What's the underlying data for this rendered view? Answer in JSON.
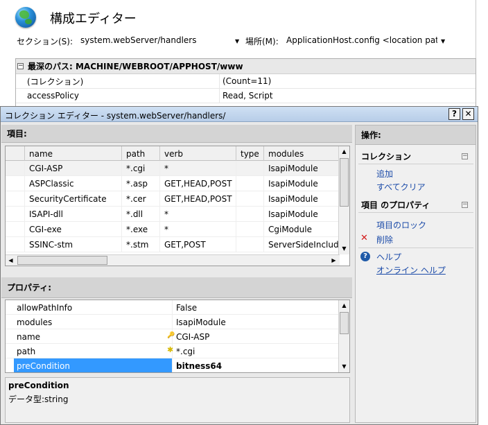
{
  "background": {
    "title": "構成エディター",
    "section_label": "セクション(S):",
    "section_value": "system.webServer/handlers",
    "location_label": "場所(M):",
    "location_value": "ApplicationHost.config <location path",
    "path_header": "最深のパス: MACHINE/WEBROOT/APPHOST/www",
    "rows": [
      {
        "name": "(コレクション)",
        "value": "(Count=11)"
      },
      {
        "name": "accessPolicy",
        "value": "Read, Script"
      }
    ]
  },
  "dialog": {
    "title": "コレクション エディター - system.webServer/handlers/",
    "help_btn": "?",
    "close_btn": "✕",
    "items_header": "項目:",
    "columns": [
      "name",
      "path",
      "verb",
      "type",
      "modules"
    ],
    "items": [
      {
        "name": "CGI-ASP",
        "path": "*.cgi",
        "verb": "*",
        "type": "",
        "modules": "IsapiModule"
      },
      {
        "name": "ASPClassic",
        "path": "*.asp",
        "verb": "GET,HEAD,POST",
        "type": "",
        "modules": "IsapiModule"
      },
      {
        "name": "SecurityCertificate",
        "path": "*.cer",
        "verb": "GET,HEAD,POST",
        "type": "",
        "modules": "IsapiModule"
      },
      {
        "name": "ISAPI-dll",
        "path": "*.dll",
        "verb": "*",
        "type": "",
        "modules": "IsapiModule"
      },
      {
        "name": "CGI-exe",
        "path": "*.exe",
        "verb": "*",
        "type": "",
        "modules": "CgiModule"
      },
      {
        "name": "SSINC-stm",
        "path": "*.stm",
        "verb": "GET,POST",
        "type": "",
        "modules": "ServerSideInclude"
      }
    ],
    "properties_header": "プロパティ:",
    "properties": [
      {
        "name": "allowPathInfo",
        "value": "False"
      },
      {
        "name": "modules",
        "value": "IsapiModule"
      },
      {
        "name": "name",
        "value": "CGI-ASP"
      },
      {
        "name": "path",
        "value": "*.cgi"
      },
      {
        "name": "preCondition",
        "value": "bitness64"
      }
    ],
    "description": {
      "title": "preCondition",
      "text": "データ型:string"
    },
    "actions": {
      "header": "操作:",
      "group_collection": "コレクション",
      "add": "追加",
      "clear_all": "すべてクリア",
      "group_item_props": "項目 のプロパティ",
      "lock_item": "項目のロック",
      "delete": "削除",
      "help": "ヘルプ",
      "online_help": "オンライン ヘルプ"
    }
  }
}
